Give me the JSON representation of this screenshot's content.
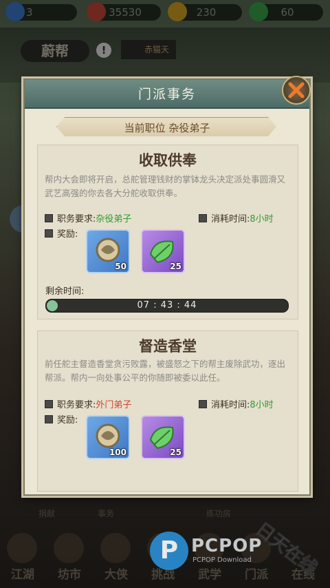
{
  "topbar": {
    "resources": [
      {
        "name": "energy",
        "value": "3",
        "color": "#3d7dd1"
      },
      {
        "name": "coins",
        "value": "35530",
        "color": "#c94a3a"
      },
      {
        "name": "gold",
        "value": "230",
        "color": "#d9a624"
      },
      {
        "name": "jade",
        "value": "60",
        "color": "#3aa84c"
      }
    ]
  },
  "bg": {
    "guild_banner": "蔚帮",
    "guild_tag": "赤猫天"
  },
  "dialog": {
    "title": "门派事务",
    "position_text": "当前职位  杂役弟子"
  },
  "task1": {
    "title": "收取供奉",
    "description": "帮内大会即将开启，总舵管理钱财的掌钵龙头决定派处事圆滑又武艺高强的你去各大分舵收取供奉。",
    "req_label": "职务要求:",
    "req_value": "杂役弟子",
    "time_label": "消耗时间:",
    "time_value": "8小时",
    "reward_label": "奖励:",
    "rewards": [
      {
        "name": "amulet",
        "count": "50"
      },
      {
        "name": "leaf",
        "count": "25"
      }
    ],
    "remaining_label": "剩余时间:",
    "remaining_time": "07 : 43 : 44",
    "progress": 0.04
  },
  "task2": {
    "title": "督造香堂",
    "description": "前任舵主督造香堂贪污败露，被盛怒之下的帮主废除武功，逐出帮派。帮内一向处事公平的你随即被委以此任。",
    "req_label": "职务要求:",
    "req_value": "外门弟子",
    "time_label": "消耗时间:",
    "time_value": "8小时",
    "reward_label": "奖励:",
    "rewards": [
      {
        "name": "amulet",
        "count": "100"
      },
      {
        "name": "leaf",
        "count": "25"
      }
    ]
  },
  "upper_nav": [
    "捐献",
    "事务",
    "",
    "练功房"
  ],
  "nav": [
    "江湖",
    "坊市",
    "大侠",
    "挑战",
    "武学",
    "门派",
    "在线"
  ],
  "watermark": {
    "logo": "P",
    "text": "PCPOP",
    "sub": "PCPOP Download",
    "stamp": "日天在线"
  }
}
